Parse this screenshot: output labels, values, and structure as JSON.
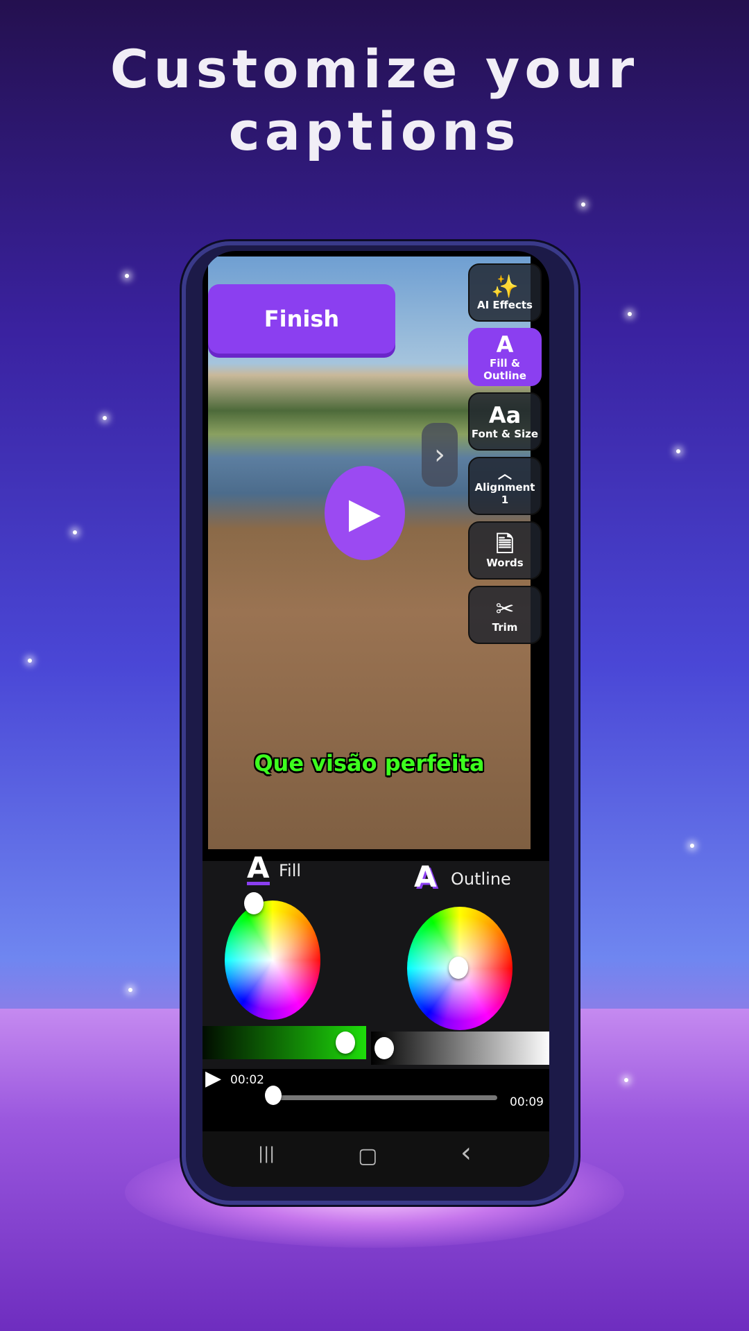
{
  "headline": {
    "line1": "Customize your",
    "line2": "captions"
  },
  "editor": {
    "finish_label": "Finish",
    "tools": [
      {
        "label": "AI Effects",
        "icon": "magic-wand-icon",
        "active": false
      },
      {
        "label": "Fill & Outline",
        "icon": "letter-a-icon",
        "active": true
      },
      {
        "label": "Font & Size",
        "icon": "font-aa-icon",
        "active": false
      },
      {
        "label": "Alignment",
        "sub": "1",
        "icon": "chevron-up-icon",
        "active": false
      },
      {
        "label": "Words",
        "icon": "document-icon",
        "active": false
      },
      {
        "label": "Trim",
        "icon": "scissors-icon",
        "active": false
      }
    ],
    "caption_text": "Que visão perfeita",
    "caption_color": "#3dff1e",
    "accent": "#8b3ff0",
    "fill": {
      "label": "Fill",
      "icon": "A"
    },
    "outline": {
      "label": "Outline",
      "icon": "A"
    },
    "fill_brightness": 0.88,
    "outline_brightness": 0.03,
    "playback": {
      "current": "00:02",
      "total": "00:09",
      "progress": 0.05
    }
  },
  "nav": {
    "recent": "|||",
    "home": "▢",
    "back": "‹"
  }
}
